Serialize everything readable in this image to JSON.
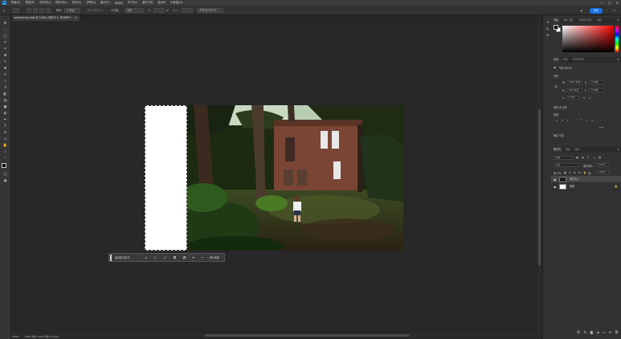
{
  "app": {
    "logo": "Ps",
    "menu": [
      "파일(F)",
      "편집(E)",
      "이미지(I)",
      "레이어(L)",
      "문자(Y)",
      "선택(S)",
      "필터(T)",
      "3D(D)",
      "보기(V)",
      "플러그인",
      "창(W)",
      "도움말(H)"
    ],
    "window_controls": [
      "—",
      "▢",
      "✕"
    ]
  },
  "options": {
    "feather_label": "페더:",
    "feather_value": "0 픽셀",
    "antialias_label": "앤티 앨리어스",
    "style_label": "스타일:",
    "style_value": "표준",
    "width_label": "폭:",
    "height_label": "높이:",
    "select_mask_label": "선택 및 마스크...",
    "share_label": "공유"
  },
  "document": {
    "tab_title": "photoshop-kids @ 100% (레이어 1, RGB/8*)",
    "tab_close": "×"
  },
  "taskbar": {
    "generate_label": "생성형 채우기",
    "select_label": "선택 해제"
  },
  "statusbar": {
    "zoom": "100%",
    "doc_info": "1600 픽셀 x 900 픽셀 (72 ppi)"
  },
  "panels": {
    "color_tabs": [
      "색상",
      "색상 견본",
      "그레이디언트",
      "패턴"
    ],
    "properties_tabs": [
      "속성",
      "조정",
      "라이브러리"
    ],
    "properties": {
      "pixel_layer": "픽셀 레이어",
      "transform_title": "변형",
      "w_label": "W",
      "w_value": "1600 픽셀",
      "h_label": "H",
      "h_value": "900 픽셀",
      "x_label": "X",
      "x_value": "0 픽셀",
      "y_label": "Y",
      "y_value": "0 픽셀",
      "angle_value": "0.00°",
      "align_title": "정렬 및 분포",
      "align_label": "정렬:",
      "more": "•••",
      "quick_actions": "빠른 작업"
    },
    "layers_tabs": [
      "레이어",
      "채널",
      "패스"
    ],
    "layers": {
      "filter_label": "종류",
      "blend_mode": "표준",
      "opacity_label": "불투명도:",
      "opacity_value": "100%",
      "lock_label": "잠그기:",
      "fill_label": "칠:",
      "fill_value": "100%",
      "items": [
        {
          "name": "레이어 1",
          "selected": true,
          "locked": false
        },
        {
          "name": "배경",
          "selected": false,
          "locked": true
        }
      ],
      "lock_glyph": "🔒",
      "eye_glyph": "👁"
    }
  },
  "colors": {
    "accent": "#1473e6",
    "foreground": "#000000",
    "background": "#ffffff"
  }
}
